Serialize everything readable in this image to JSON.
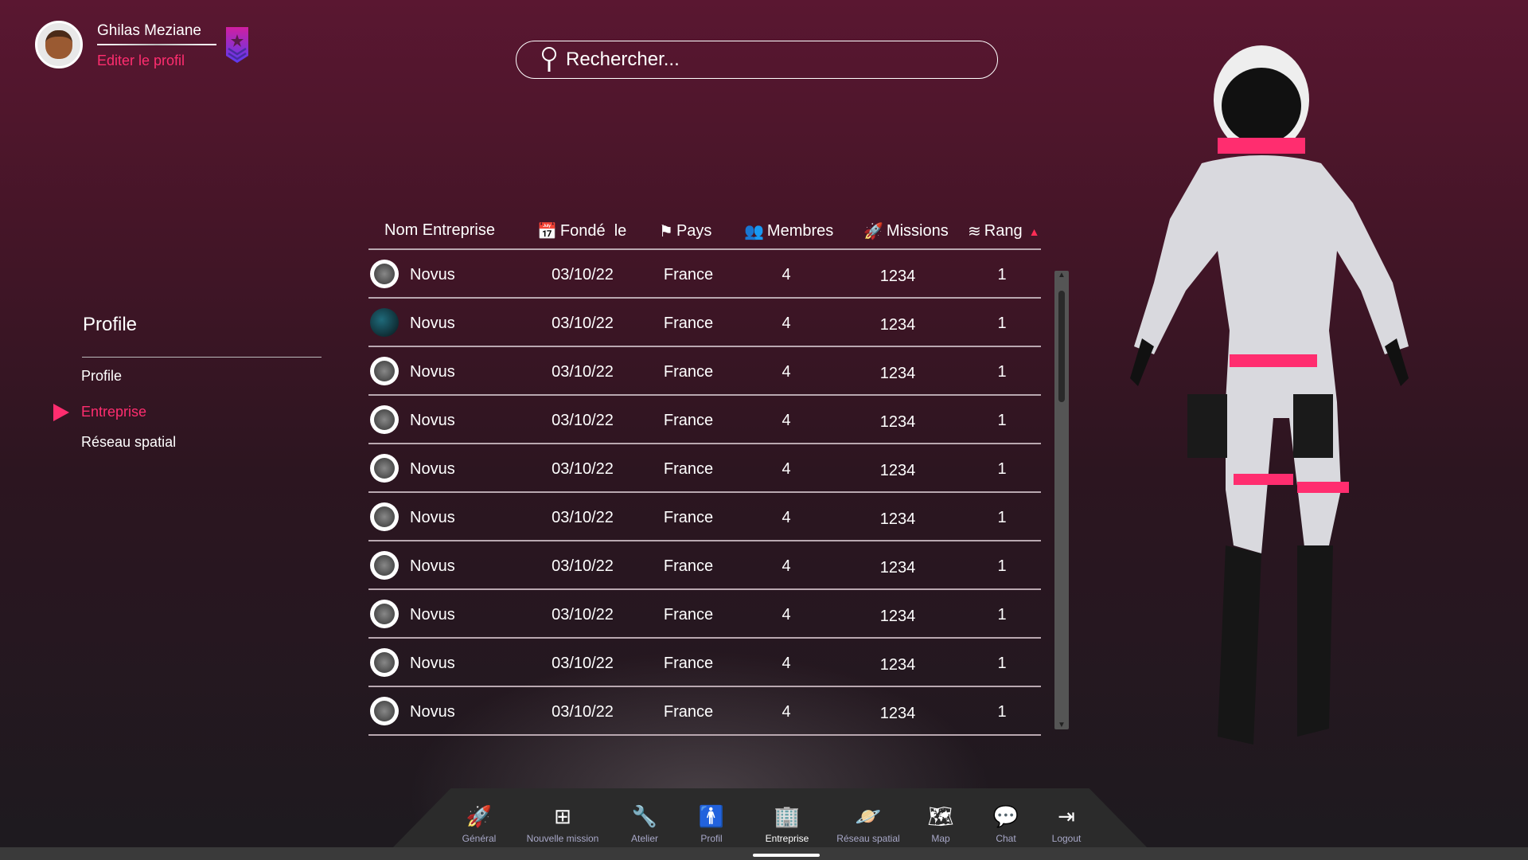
{
  "user": {
    "name": "Ghilas Meziane",
    "edit_label": "Editer le profil"
  },
  "search": {
    "placeholder": "Rechercher..."
  },
  "sidebar": {
    "title": "Profile",
    "items": [
      {
        "label": "Profile"
      },
      {
        "label": "Entreprise",
        "active": true
      },
      {
        "label": "Réseau spatial"
      }
    ]
  },
  "table": {
    "headers": {
      "name": "Nom Entreprise",
      "founded": "Fondé  le",
      "country": "Pays",
      "members": "Membres",
      "missions": "Missions",
      "rank": "Rang"
    },
    "sort": "rank-ascending",
    "rows": [
      {
        "name": "Novus",
        "founded": "03/10/22",
        "country": "France",
        "members": "4",
        "missions": "1234",
        "rank": "1"
      },
      {
        "name": "Novus",
        "founded": "03/10/22",
        "country": "France",
        "members": "4",
        "missions": "1234",
        "rank": "1",
        "logo": "spacex"
      },
      {
        "name": "Novus",
        "founded": "03/10/22",
        "country": "France",
        "members": "4",
        "missions": "1234",
        "rank": "1"
      },
      {
        "name": "Novus",
        "founded": "03/10/22",
        "country": "France",
        "members": "4",
        "missions": "1234",
        "rank": "1"
      },
      {
        "name": "Novus",
        "founded": "03/10/22",
        "country": "France",
        "members": "4",
        "missions": "1234",
        "rank": "1"
      },
      {
        "name": "Novus",
        "founded": "03/10/22",
        "country": "France",
        "members": "4",
        "missions": "1234",
        "rank": "1"
      },
      {
        "name": "Novus",
        "founded": "03/10/22",
        "country": "France",
        "members": "4",
        "missions": "1234",
        "rank": "1"
      },
      {
        "name": "Novus",
        "founded": "03/10/22",
        "country": "France",
        "members": "4",
        "missions": "1234",
        "rank": "1"
      },
      {
        "name": "Novus",
        "founded": "03/10/22",
        "country": "France",
        "members": "4",
        "missions": "1234",
        "rank": "1"
      },
      {
        "name": "Novus",
        "founded": "03/10/22",
        "country": "France",
        "members": "4",
        "missions": "1234",
        "rank": "1"
      }
    ]
  },
  "nav": [
    {
      "label": "Général",
      "icon": "rocket-icon"
    },
    {
      "label": "Nouvelle mission",
      "icon": "plus-icon"
    },
    {
      "label": "Atelier",
      "icon": "wrench-icon"
    },
    {
      "label": "Profil",
      "icon": "person-icon"
    },
    {
      "label": "Entreprise",
      "icon": "building-icon",
      "active": true
    },
    {
      "label": "Réseau spatial",
      "icon": "planet-icon"
    },
    {
      "label": "Map",
      "icon": "map-icon"
    },
    {
      "label": "Chat",
      "icon": "chat-icon"
    },
    {
      "label": "Logout",
      "icon": "logout-icon"
    }
  ],
  "colors": {
    "accent": "#ff2d6f"
  }
}
